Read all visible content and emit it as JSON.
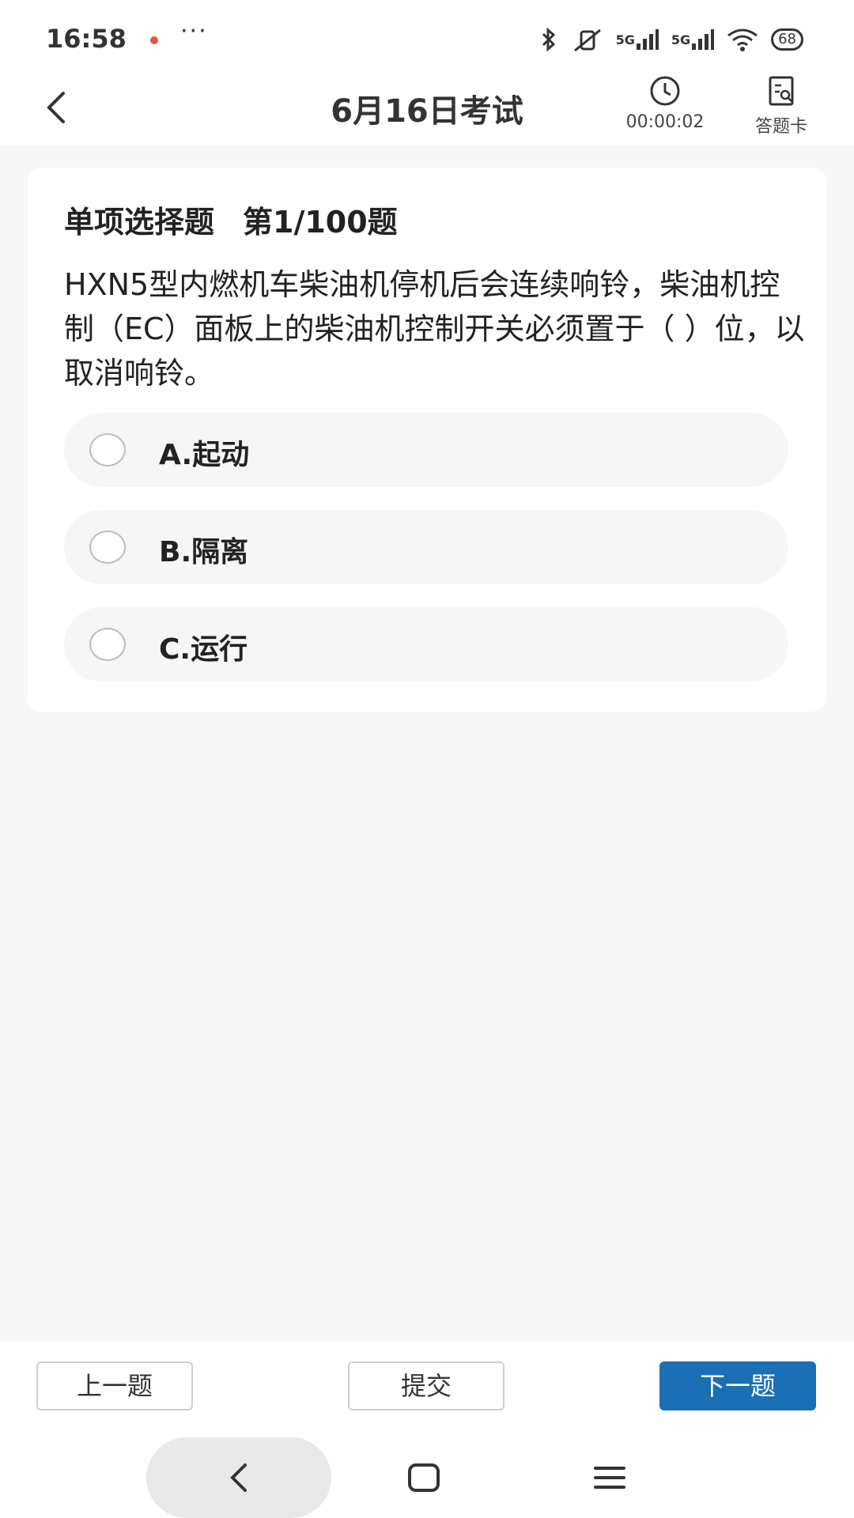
{
  "status_bar": {
    "time": "16:58",
    "more": "···",
    "network_1": "5G",
    "network_2": "5G",
    "battery": "68"
  },
  "header": {
    "title": "6月16日考试",
    "timer": "00:00:02",
    "answer_card_label": "答题卡"
  },
  "question": {
    "type_label": "单项选择题",
    "number_label": "第1/100题",
    "text": "HXN5型内燃机车柴油机停机后会连续响铃，柴油机控制（EC）面板上的柴油机控制开关必须置于（ ）位，以取消响铃。",
    "options": [
      {
        "label": "A.起动"
      },
      {
        "label": "B.隔离"
      },
      {
        "label": "C.运行"
      }
    ]
  },
  "footer": {
    "prev_label": "上一题",
    "submit_label": "提交",
    "next_label": "下一题"
  },
  "colors": {
    "primary": "#1a6fb5",
    "background": "#f7f7f7",
    "option_bg": "#f6f6f6"
  },
  "icons": [
    "bluetooth-icon",
    "mute-vibrate-icon",
    "signal-icon",
    "wifi-icon",
    "battery-icon",
    "back-arrow-icon",
    "clock-icon",
    "answer-card-icon",
    "nav-back-icon",
    "nav-home-icon",
    "nav-menu-icon"
  ]
}
